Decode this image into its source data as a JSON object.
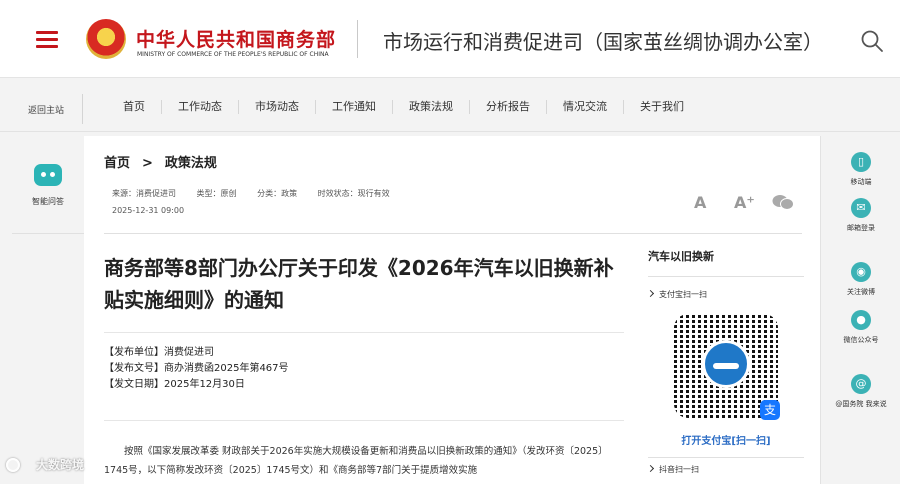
{
  "header": {
    "ministry_cn": "中华人民共和国商务部",
    "ministry_en": "MINISTRY OF COMMERCE OF THE PEOPLE'S REPUBLIC OF CHINA",
    "dept_title": "市场运行和消费促进司（国家茧丝绸协调办公室）",
    "accent_color": "#c4161c"
  },
  "nav": {
    "back_home": "返回主站",
    "items": [
      "首页",
      "工作动态",
      "市场动态",
      "工作通知",
      "政策法规",
      "分析报告",
      "情况交流",
      "关于我们"
    ]
  },
  "left_sidebar": {
    "assistant_label": "智能问答"
  },
  "right_sidebar": {
    "items": [
      {
        "label": "移动端",
        "icon": "mobile-icon"
      },
      {
        "label": "邮箱登录",
        "icon": "mail-icon"
      },
      {
        "label": "关注微博",
        "icon": "weibo-icon"
      },
      {
        "label": "微信公众号",
        "icon": "wechat-icon"
      },
      {
        "label": "@国务院 我来说",
        "icon": "at-icon"
      }
    ]
  },
  "breadcrumb": {
    "home": "首页",
    "separator": ">",
    "current": "政策法规"
  },
  "meta": {
    "source": "来源：消费促进司",
    "type": "类型：原创",
    "category": "分类：政策",
    "status": "时效状态：现行有效",
    "date": "2025-12-31 09:00"
  },
  "tools": {
    "font_large": "A",
    "font_small": "A⁺"
  },
  "article": {
    "title": "商务部等8部门办公厅关于印发《2026年汽车以旧换新补贴实施细则》的通知",
    "issuer": "【发布单位】消费促进司",
    "doc_no": "【发布文号】商办消费函2025年第467号",
    "issue_date": "【发文日期】2025年12月30日",
    "body": "按照《国家发展改革委 财政部关于2026年实施大规模设备更新和消费品以旧换新政策的通知》（发改环资〔2025〕1745号，以下简称发改环资〔2025〕1745号文）和《商务部等7部门关于提质增效实施"
  },
  "qr_panel": {
    "heading": "汽车以旧换新",
    "sub1": "支付宝扫一扫",
    "caption": "打开支付宝[扫一扫]",
    "sub2": "抖音扫一扫"
  },
  "watermark": {
    "text": "大数跨境"
  }
}
